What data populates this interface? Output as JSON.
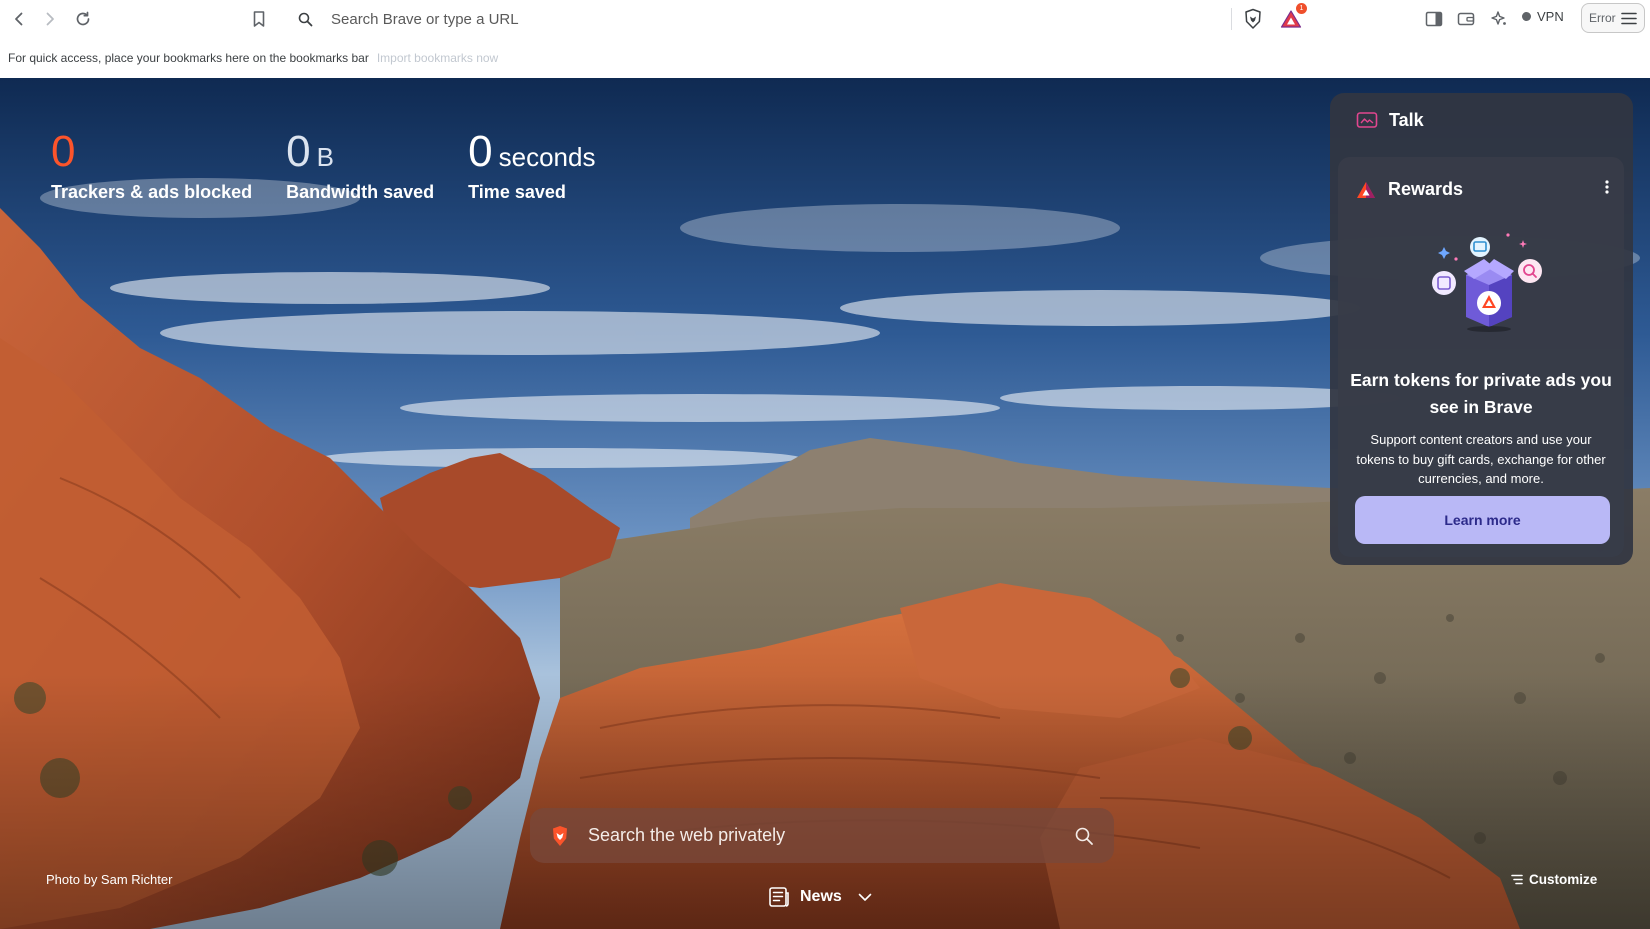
{
  "toolbar": {
    "url_placeholder": "Search Brave or type a URL",
    "rewards_badge_count": "1",
    "vpn_label": "VPN",
    "error_label": "Error"
  },
  "bookmarks_bar": {
    "message": "For quick access, place your bookmarks here on the bookmarks bar",
    "import_link": "Import bookmarks now"
  },
  "stats": [
    {
      "value": "0",
      "unit": "",
      "label": "Trackers & ads blocked",
      "color": "#fb542b"
    },
    {
      "value": "0",
      "unit": "B",
      "label": "Bandwidth saved",
      "color": "#dbe3ef"
    },
    {
      "value": "0",
      "unit": "seconds",
      "label": "Time saved",
      "color": "#ffffff"
    }
  ],
  "widgets": {
    "talk": {
      "title": "Talk"
    },
    "rewards": {
      "title": "Rewards",
      "headline": "Earn tokens for private ads you see in Brave",
      "description": "Support content creators and use your tokens to buy gift cards, exchange for other currencies, and more.",
      "cta": "Learn more"
    }
  },
  "search": {
    "placeholder": "Search the web privately"
  },
  "photo_credit": "Photo by Sam Richter",
  "customize_label": "Customize",
  "news_label": "News",
  "colors": {
    "brave_orange": "#fb542b",
    "cta_purple": "#b9b8f6",
    "widget_bg": "#323642"
  }
}
